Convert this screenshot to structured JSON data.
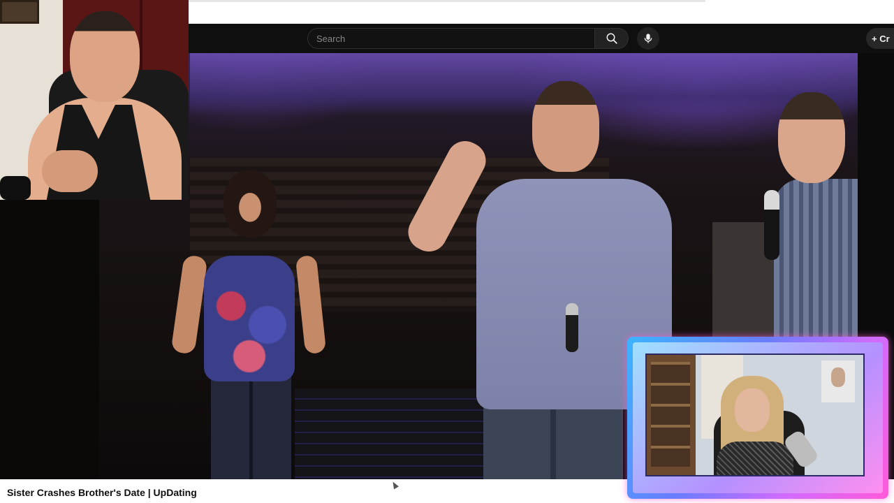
{
  "search": {
    "placeholder": "Search"
  },
  "header": {
    "create_label": "+ Cr"
  },
  "video": {
    "title": "Sister Crashes Brother's Date | UpDating"
  },
  "icons": {
    "search": "search-icon",
    "mic": "microphone-icon",
    "create": "plus-icon"
  },
  "colors": {
    "frame_gradient_start": "#3cb4ff",
    "frame_gradient_end": "#ff5ad9",
    "header_bg": "#0f0f0f"
  }
}
